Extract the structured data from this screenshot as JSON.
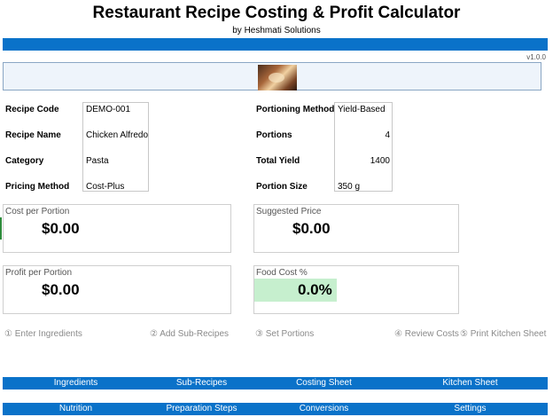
{
  "header": {
    "title": "Restaurant Recipe Costing & Profit Calculator",
    "subtitle": "by Heshmati Solutions",
    "version": "v1.0.0"
  },
  "recipe": {
    "code_label": "Recipe Code",
    "code_value": "DEMO-001",
    "name_label": "Recipe Name",
    "name_value": "Chicken Alfredo",
    "category_label": "Category",
    "category_value": "Pasta",
    "pricing_label": "Pricing Method",
    "pricing_value": "Cost-Plus"
  },
  "portioning": {
    "method_label": "Portioning Method",
    "method_value": "Yield-Based",
    "portions_label": "Portions",
    "portions_value": "4",
    "yield_label": "Total Yield",
    "yield_value": "1400",
    "size_label": "Portion Size",
    "size_value": "350 g"
  },
  "metrics": {
    "cost_label": "Cost per Portion",
    "cost_value": "$0.00",
    "price_label": "Suggested Price",
    "price_value": "$0.00",
    "profit_label": "Profit per Portion",
    "profit_value": "$0.00",
    "foodcost_label": "Food Cost %",
    "foodcost_value": "0.0%"
  },
  "steps": [
    "① Enter Ingredients",
    "② Add Sub-Recipes",
    "③ Set Portions",
    "④ Review Costs",
    "⑤ Print Kitchen Sheet"
  ],
  "nav_row1": [
    "Ingredients",
    "Sub-Recipes",
    "Costing Sheet",
    "Kitchen Sheet"
  ],
  "nav_row2": [
    "Nutrition",
    "Preparation Steps",
    "Conversions",
    "Settings"
  ],
  "colors": {
    "accent_blue": "#0a72c9",
    "banner_bg": "#eef4fb",
    "foodcost_fill": "#c6efce",
    "step_text": "#8a8a8a"
  },
  "icons": {
    "logo": "food-photo-logo"
  }
}
